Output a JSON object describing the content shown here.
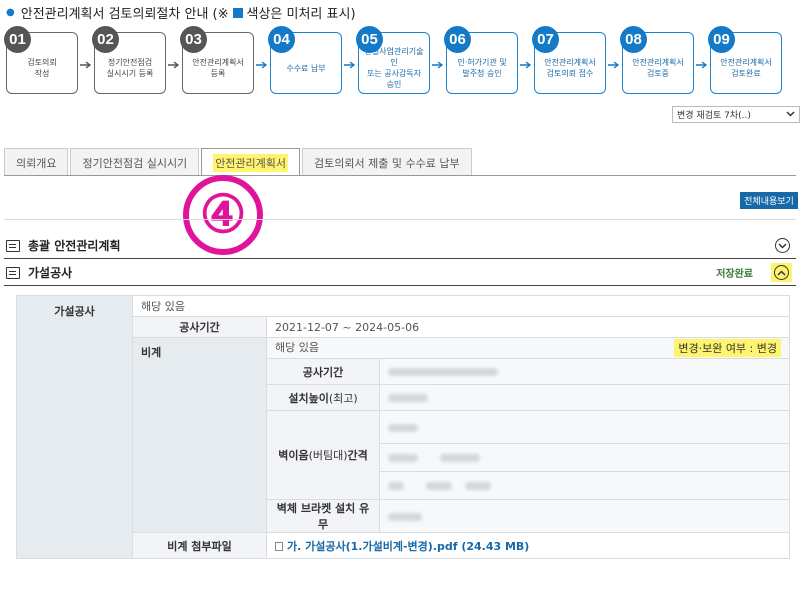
{
  "header": {
    "title_prefix": "안전관리계획서 검토의뢰절차 안내 (※",
    "title_suffix": "색상은 미처리 표시)"
  },
  "steps": [
    {
      "num": "01",
      "label": "검토의뢰\n작성",
      "active": false
    },
    {
      "num": "02",
      "label": "정기안전점검\n실시시기 등록",
      "active": false
    },
    {
      "num": "03",
      "label": "안전관리계획서\n등록",
      "active": false
    },
    {
      "num": "04",
      "label": "수수료 납부",
      "active": true
    },
    {
      "num": "05",
      "label": "건설사업관리기술인\n또는 공사감독자\n승인",
      "active": true
    },
    {
      "num": "06",
      "label": "인·허가기관 및\n발주청 승인",
      "active": true
    },
    {
      "num": "07",
      "label": "안전관리계획서\n검토의뢰 접수",
      "active": true
    },
    {
      "num": "08",
      "label": "안전관리계획서\n검토중",
      "active": true
    },
    {
      "num": "09",
      "label": "안전관리계획서\n검토완료",
      "active": true
    }
  ],
  "colors": {
    "accent": "#1479c7",
    "highlight": "#fff46e",
    "annotation": "#e0149b"
  },
  "version_select": {
    "value": "변경 재검토 7차(..)"
  },
  "tabs": [
    {
      "label": "의뢰개요"
    },
    {
      "label": "정기안전점검 실시시기"
    },
    {
      "label": "안전관리계획서"
    },
    {
      "label": "검토의뢰서 제출 및 수수료 납부"
    }
  ],
  "annotation": "④",
  "full_view_label": "전체내용보기",
  "sections": {
    "general": {
      "title": "총괄 안전관리계획"
    },
    "temp": {
      "title": "가설공사",
      "status": "저장완료"
    }
  },
  "detail": {
    "temp_label": "가설공사",
    "temp_value": "해당 있음",
    "period_label": "공사기간",
    "period_value": "2021-12-07 ~ 2024-05-06",
    "scaffold_label": "비계",
    "scaffold_value": "해당 있음",
    "change_badge": "변경·보완 여부 :   변경",
    "sub_period_label": "공사기간",
    "height_label": "설치높이",
    "height_suffix": "(최고)",
    "wall_label_a": "벽이음",
    "wall_label_b": "(버팀대)",
    "wall_label_c": "간격",
    "bracket_label": "벽체 브라켓 설치 유무",
    "attach_label": "비계 첨부파일",
    "attach_file": "가. 가설공사(1.가설비계-변경).pdf (24.43 MB)"
  }
}
